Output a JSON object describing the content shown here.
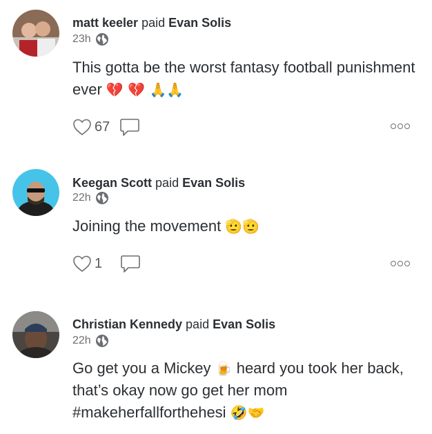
{
  "posts": [
    {
      "payer": "matt keeler",
      "verb": "paid",
      "payee": "Evan Solis",
      "time": "23h",
      "text": "This gotta be the worst fantasy football punishment ever",
      "emoji": "💔 💔 🙏🙏",
      "likes": "67",
      "icons": [
        "avatar",
        "globe-icon",
        "heart-icon",
        "comment-icon",
        "more-icon"
      ]
    },
    {
      "payer": "Keegan Scott",
      "verb": "paid",
      "payee": "Evan Solis",
      "time": "22h",
      "text": "Joining the movement",
      "emoji": "🫡🫡",
      "likes": "1",
      "icons": [
        "avatar",
        "globe-icon",
        "heart-icon",
        "comment-icon",
        "more-icon"
      ]
    },
    {
      "payer": "Christian Kennedy",
      "verb": "paid",
      "payee": "Evan Solis",
      "time": "22h",
      "text_part1": "Go get you a Mickey",
      "emoji_mid": "🍺",
      "text_part2": "heard you took her back, that’s okay now go get her mom #makeherfallforthehesi",
      "emoji_end": "🤣🤝",
      "icons": [
        "avatar",
        "globe-icon"
      ]
    }
  ],
  "colors": {
    "text": "#2b2f33",
    "muted": "#6b6f73",
    "background": "#ffffff"
  }
}
